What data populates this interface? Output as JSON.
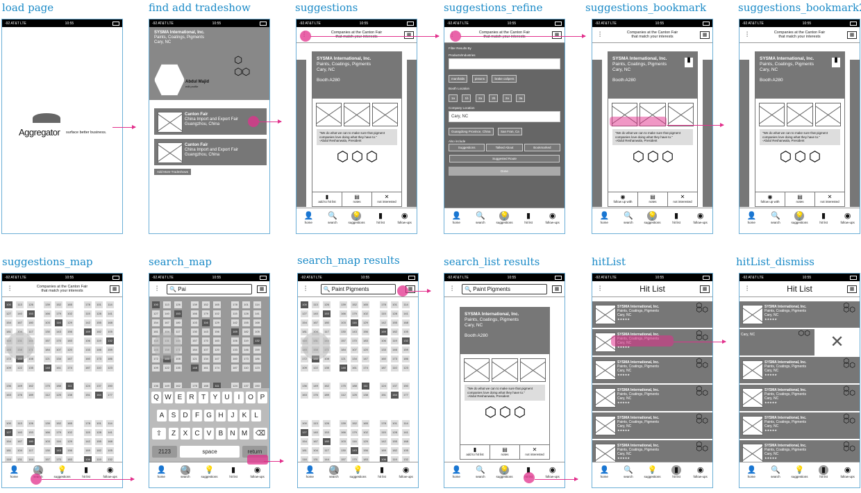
{
  "screens": [
    {
      "label": "load page"
    },
    {
      "label": "find add tradeshow"
    },
    {
      "label": "suggestions"
    },
    {
      "label": "suggestions_refine"
    },
    {
      "label": "suggestions_bookmark"
    },
    {
      "label": "suggestions_bookmark2"
    },
    {
      "label": "suggestions_map"
    },
    {
      "label": "search_map"
    },
    {
      "label": "search_map results"
    },
    {
      "label": "search_list results"
    },
    {
      "label": "hitList"
    },
    {
      "label": "hitList_dismiss"
    }
  ],
  "status": {
    "carrier": "-92 AT&T LTE",
    "time": "10:55"
  },
  "brand": {
    "name": "Aggregator",
    "tagline": "surface better business."
  },
  "profile": {
    "name": "Abdul Majid",
    "sub": "edit profile"
  },
  "tradeshow": {
    "title": "Canton Fair",
    "line1": "China Import and Export Fair",
    "line2": "Guangzhou, China",
    "add_btn": "Add More Tradeshows"
  },
  "company": {
    "name": "SYSMA International, Inc.",
    "industry": "Paints, Coatings, Pigments",
    "city": "Cary, NC",
    "booth": "Booth A280",
    "quote": "\"We do what we can to make sure that pigment companies love doing what they have to.\"",
    "quote_by": "-Abdul Reshanwala, President"
  },
  "header": {
    "line1": "Companies at the Canton Fair",
    "line2": "that match your interests",
    "hitlist": "Hit List"
  },
  "actions": {
    "add": "add to hit list",
    "notes": "notes",
    "not": "not interested",
    "follow": "follow up with"
  },
  "tabs": {
    "home": "home",
    "search": "search",
    "suggestions": "suggestions",
    "hitlist": "hit list",
    "followups": "follow-ups"
  },
  "refine": {
    "title": "Filter Results By",
    "products": "Products/Industries",
    "chips": [
      "manifolds",
      "pistons",
      "brake calipers"
    ],
    "booth": "Booth Location",
    "booth_opts": [
      "1a",
      "1b",
      "2a",
      "2b",
      "2a",
      "3a"
    ],
    "loc": "Company Location",
    "loc_val": "Cary, NC",
    "loc_chips": [
      "Guangdong Province, China",
      "San Fran, Ca"
    ],
    "also": "Also include",
    "also_opts": [
      "Suggestions",
      "Talked About",
      "Bookmarked"
    ],
    "route": "Suggested Route",
    "done": "Done"
  },
  "search": {
    "query_short": "Pai",
    "query_full": "Paint Pigments",
    "space": "space",
    "ret": "return",
    "num": "2123"
  },
  "keyboard": {
    "row1": [
      "Q",
      "W",
      "E",
      "R",
      "T",
      "Y",
      "U",
      "I",
      "O",
      "P"
    ],
    "row2": [
      "A",
      "S",
      "D",
      "F",
      "G",
      "H",
      "J",
      "K",
      "L"
    ],
    "row3": [
      "Z",
      "X",
      "C",
      "V",
      "B",
      "N",
      "M"
    ]
  },
  "hit": {
    "name": "SYSMA International, Inc.",
    "industry": "Paints, Coatings, Pigments",
    "city": "Cary, NC",
    "stars": "★★★★★"
  },
  "colors": {
    "accent": "#e2308c",
    "label": "#1a8ac7",
    "card": "#777777"
  }
}
